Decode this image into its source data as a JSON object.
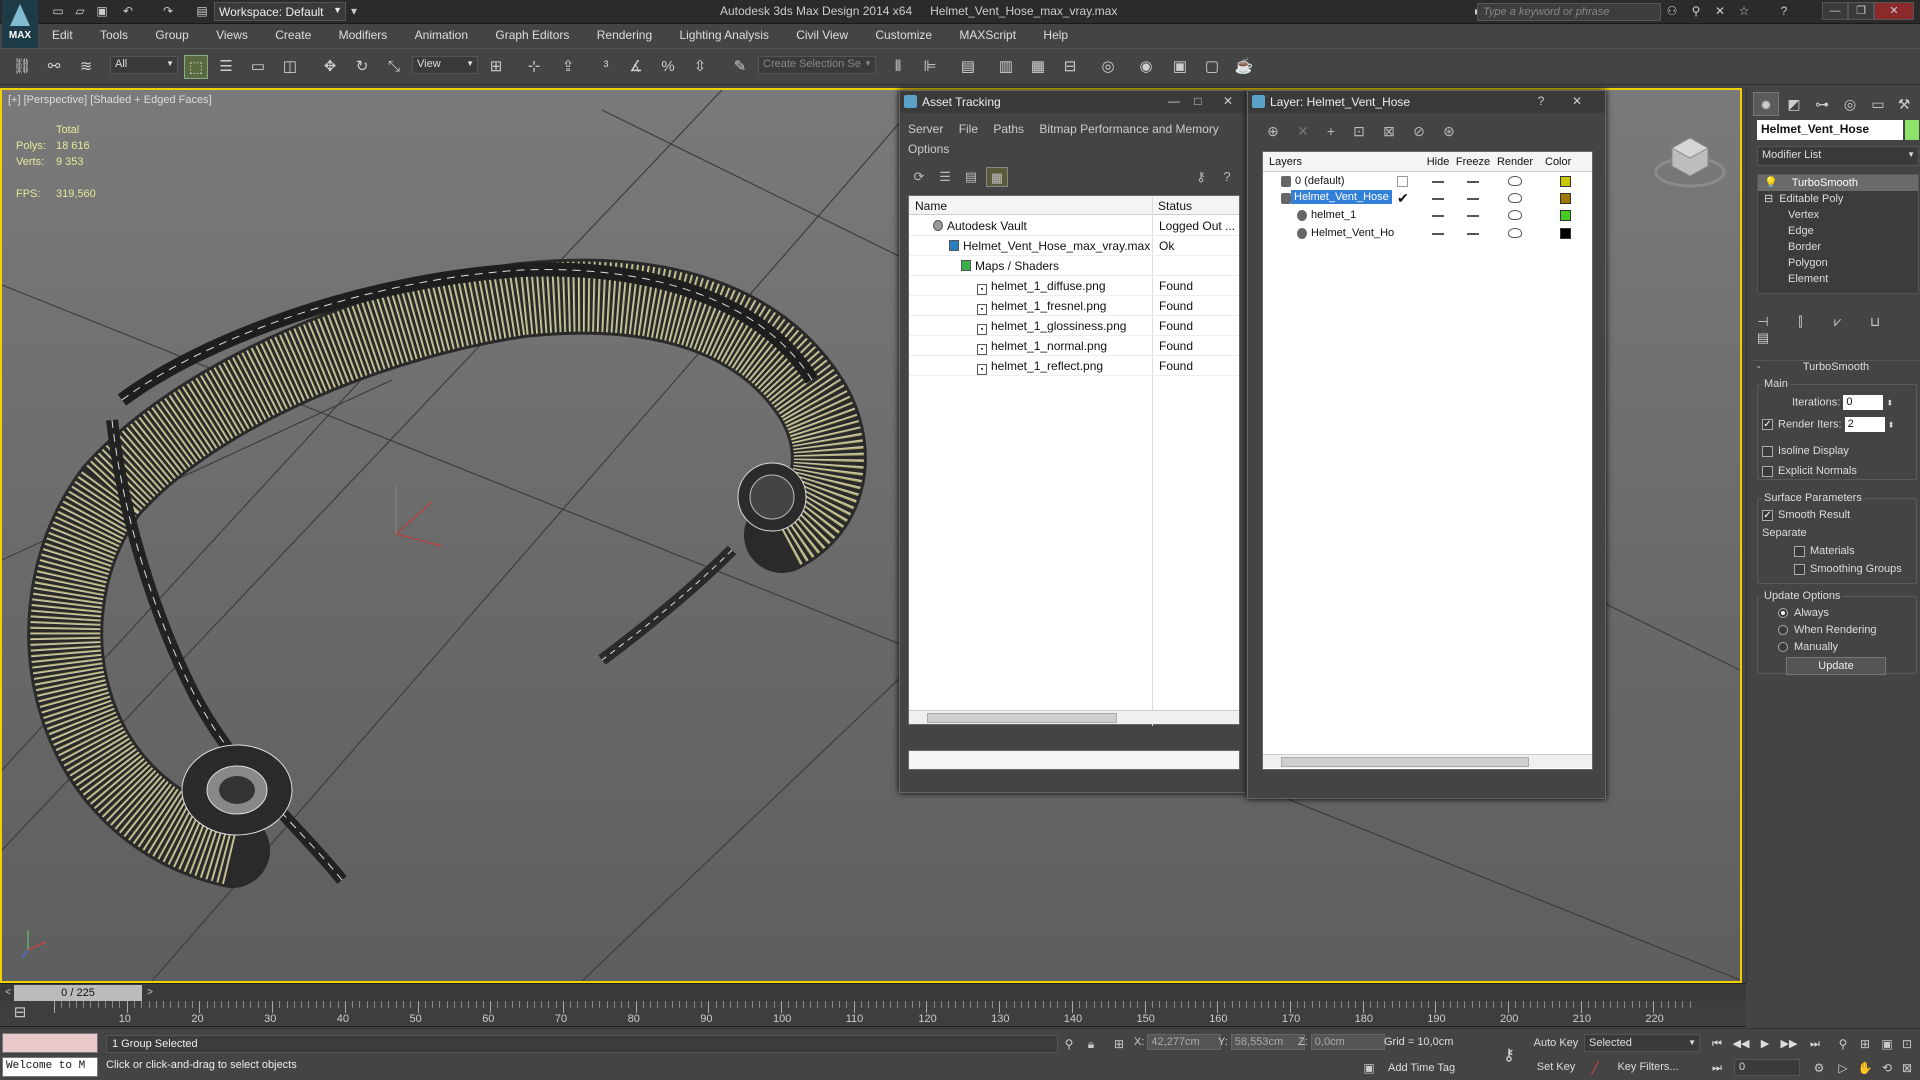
{
  "app": {
    "logo_text": "MAX",
    "title": "Autodesk 3ds Max Design 2014 x64",
    "file": "Helmet_Vent_Hose_max_vray.max",
    "workspace": "Workspace: Default",
    "search_placeholder": "Type a keyword or phrase"
  },
  "menu": [
    "Edit",
    "Tools",
    "Group",
    "Views",
    "Create",
    "Modifiers",
    "Animation",
    "Graph Editors",
    "Rendering",
    "Lighting Analysis",
    "Civil View",
    "Customize",
    "MAXScript",
    "Help"
  ],
  "toolbar": {
    "filter": "All",
    "ref_coord": "View",
    "selection_set_placeholder": "Create Selection Se"
  },
  "viewport": {
    "label": "[+] [Perspective] [Shaded + Edged Faces]",
    "stats": {
      "header": "Total",
      "polys_label": "Polys:",
      "polys": "18 616",
      "verts_label": "Verts:",
      "verts": "9 353",
      "fps_label": "FPS:",
      "fps": "319,560"
    }
  },
  "asset_tracking": {
    "title": "Asset Tracking",
    "menu": [
      "Server",
      "File",
      "Paths",
      "Bitmap Performance and Memory",
      "Options"
    ],
    "columns": [
      "Name",
      "Status"
    ],
    "rows": [
      {
        "name": "Autodesk Vault",
        "status": "Logged Out ..."
      },
      {
        "name": "Helmet_Vent_Hose_max_vray.max",
        "status": "Ok"
      },
      {
        "name": "Maps / Shaders",
        "status": ""
      },
      {
        "name": "helmet_1_diffuse.png",
        "status": "Found"
      },
      {
        "name": "helmet_1_fresnel.png",
        "status": "Found"
      },
      {
        "name": "helmet_1_glossiness.png",
        "status": "Found"
      },
      {
        "name": "helmet_1_normal.png",
        "status": "Found"
      },
      {
        "name": "helmet_1_reflect.png",
        "status": "Found"
      }
    ]
  },
  "layer_window": {
    "title": "Layer: Helmet_Vent_Hose",
    "columns": [
      "Layers",
      "Hide",
      "Freeze",
      "Render",
      "Color"
    ],
    "rows": [
      {
        "name": "0 (default)",
        "color": "#c8c800"
      },
      {
        "name": "Helmet_Vent_Hose",
        "color": "#a07800"
      },
      {
        "name": "helmet_1",
        "color": "#44cc22"
      },
      {
        "name": "Helmet_Vent_Ho",
        "color": "#000000"
      }
    ]
  },
  "command_panel": {
    "object_name": "Helmet_Vent_Hose",
    "object_color": "#8be36a",
    "modifier_list": "Modifier List",
    "stack": [
      "TurboSmooth",
      "Editable Poly",
      "Vertex",
      "Edge",
      "Border",
      "Polygon",
      "Element"
    ],
    "rollout_title": "TurboSmooth",
    "main_group": "Main",
    "iterations_label": "Iterations:",
    "iterations": "0",
    "render_iters_label": "Render Iters:",
    "render_iters": "2",
    "isoline": "Isoline Display",
    "explicit_normals": "Explicit Normals",
    "surface_group": "Surface Parameters",
    "smooth_result": "Smooth Result",
    "separate": "Separate",
    "materials": "Materials",
    "smoothing_groups": "Smoothing Groups",
    "update_group": "Update Options",
    "always": "Always",
    "when_rendering": "When Rendering",
    "manually": "Manually",
    "update_button": "Update"
  },
  "timeline": {
    "frame": "0 / 225",
    "ticks": [
      10,
      20,
      30,
      40,
      50,
      60,
      70,
      80,
      90,
      100,
      110,
      120,
      130,
      140,
      150,
      160,
      170,
      180,
      190,
      200,
      210,
      220
    ]
  },
  "status": {
    "welcome": "Welcome to M",
    "selection": "1 Group Selected",
    "prompt": "Click or click-and-drag to select objects",
    "x_label": "X:",
    "x": "42,277cm",
    "y_label": "Y:",
    "y": "58,553cm",
    "z_label": "Z:",
    "z": "0,0cm",
    "grid": "Grid = 10,0cm",
    "add_time_tag": "Add Time Tag",
    "auto_key": "Auto Key",
    "set_key": "Set Key",
    "key_mode": "Selected",
    "key_filters": "Key Filters...",
    "frame": "0"
  }
}
